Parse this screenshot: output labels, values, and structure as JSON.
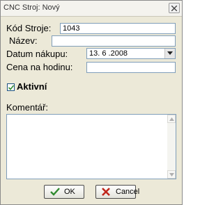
{
  "window": {
    "title": "CNC Stroj: Nový"
  },
  "form": {
    "kod_label": "Kód Stroje:",
    "kod_value": "1043",
    "nazev_label": "Název:",
    "nazev_value": "",
    "datum_label": "Datum nákupu:",
    "datum_value": "13. 6 .2008",
    "cena_label": "Cena na hodinu:",
    "cena_value": "",
    "aktivni_label": "Aktivní",
    "aktivni_checked": true,
    "komentar_label": "Komentář:",
    "komentar_value": ""
  },
  "buttons": {
    "ok_label": "OK",
    "cancel_label": "Cancel"
  },
  "colors": {
    "ok_check": "#2f8a2f",
    "cancel_x": "#c0261b",
    "checkbox_mark": "#2f8a2f"
  },
  "icons": {
    "close": "close-icon",
    "dropdown": "chevron-down-icon",
    "ok": "checkmark-icon",
    "cancel": "x-icon"
  }
}
